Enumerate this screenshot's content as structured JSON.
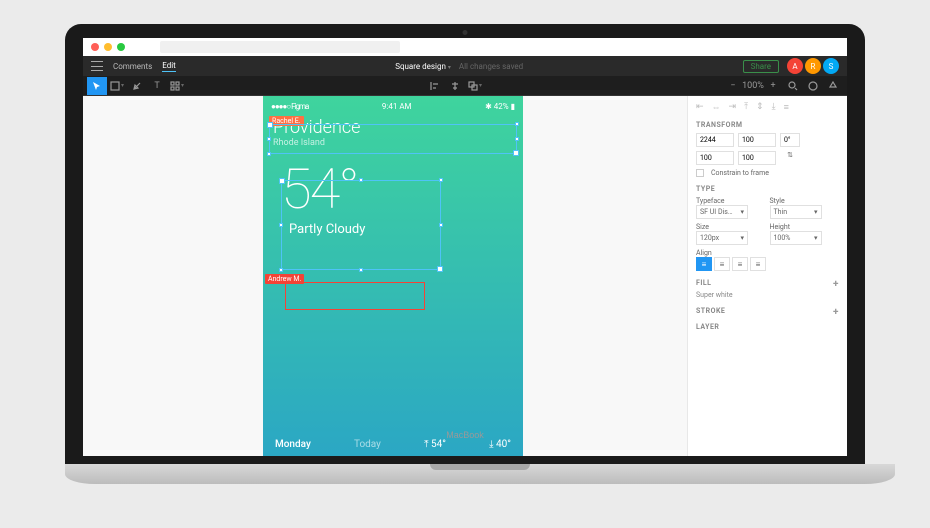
{
  "menu": {
    "comments": "Comments",
    "edit": "Edit"
  },
  "header": {
    "title": "Square design",
    "status": "All changes saved",
    "share": "Share",
    "avatars": [
      "A",
      "R",
      "S"
    ]
  },
  "users": {
    "rachel": "Rachel E.",
    "andrew": "Andrew M."
  },
  "weather": {
    "carrier": "●●●●○ Figma",
    "time": "9:41 AM",
    "bt": "42%",
    "city": "Providence",
    "state": "Rhode Island",
    "temp": "54°",
    "cond": "Partly Cloudy",
    "day": "Monday",
    "today": "Today",
    "hi": "54°",
    "lo": "40°"
  },
  "transform": {
    "title": "TRANSFORM",
    "x": "2244",
    "y": "100",
    "r": "0°",
    "w": "100",
    "h": "100",
    "constrain": "Constrain to frame"
  },
  "type": {
    "title": "TYPE",
    "typeface_lbl": "Typeface",
    "style_lbl": "Style",
    "typeface": "SF UI Dis…",
    "style": "Thin",
    "size_lbl": "Size",
    "height_lbl": "Height",
    "size": "120px",
    "height": "100%",
    "align_lbl": "Align"
  },
  "fill": {
    "title": "FILL",
    "value": "Super white"
  },
  "stroke": {
    "title": "STROKE"
  },
  "layer": {
    "title": "LAYER"
  },
  "laptop": "MacBook"
}
